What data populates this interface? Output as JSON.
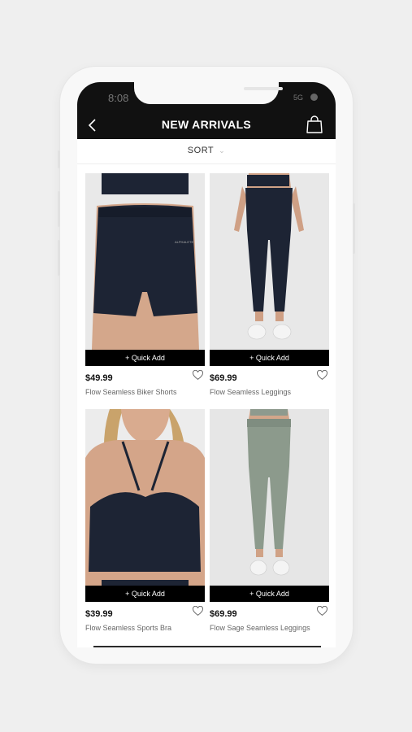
{
  "status_bar": {
    "time": "8:08",
    "signal": "5G"
  },
  "header": {
    "title": "NEW ARRIVALS",
    "back_icon": "chevron-left-icon",
    "bag_icon": "shopping-bag-icon"
  },
  "sort": {
    "label": "SORT",
    "icon": "chevron-down-icon"
  },
  "products": [
    {
      "price": "$49.99",
      "name": "Flow Seamless Biker Shorts",
      "quick_add": "+ Quick Add"
    },
    {
      "price": "$69.99",
      "name": "Flow Seamless Leggings",
      "quick_add": "+ Quick Add"
    },
    {
      "price": "$39.99",
      "name": "Flow Seamless Sports Bra",
      "quick_add": "+ Quick Add"
    },
    {
      "price": "$69.99",
      "name": "Flow Sage Seamless Leggings",
      "quick_add": "+ Quick Add"
    }
  ],
  "colors": {
    "header_bg": "#111111",
    "navy": "#1b2233",
    "sage": "#8c9a8c",
    "photo_bg": "#ececec"
  }
}
